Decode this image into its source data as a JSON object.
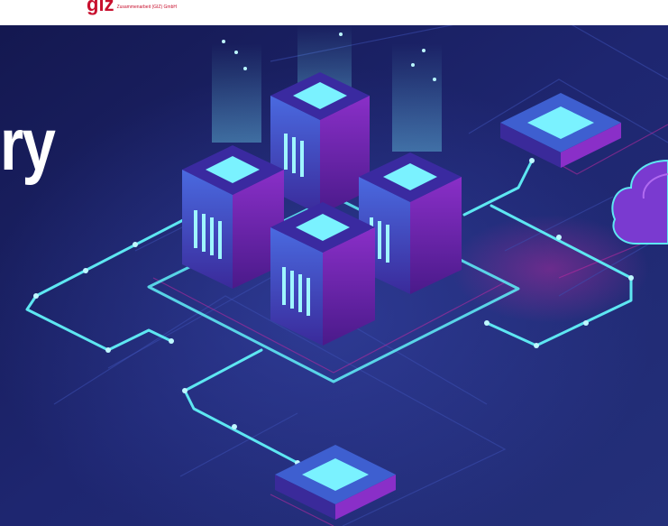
{
  "header": {
    "logo_text": "giz",
    "logo_tagline": "Zusammenarbeit (GIZ) GmbH"
  },
  "hero": {
    "title_fragment": "ry"
  },
  "colors": {
    "header_background": "#ffffff",
    "logo_red": "#c8102e",
    "background_dark": "#141850",
    "background_mid": "#24307a",
    "neon_cyan": "#5ee7f2",
    "neon_magenta": "#c02aa0",
    "server_purple": "#6a2fb8",
    "server_blue": "#3e5fd0",
    "screen_cyan": "#7af2ff"
  },
  "icons": [
    "server-stack-icon",
    "cloud-icon",
    "network-chip-icon"
  ]
}
